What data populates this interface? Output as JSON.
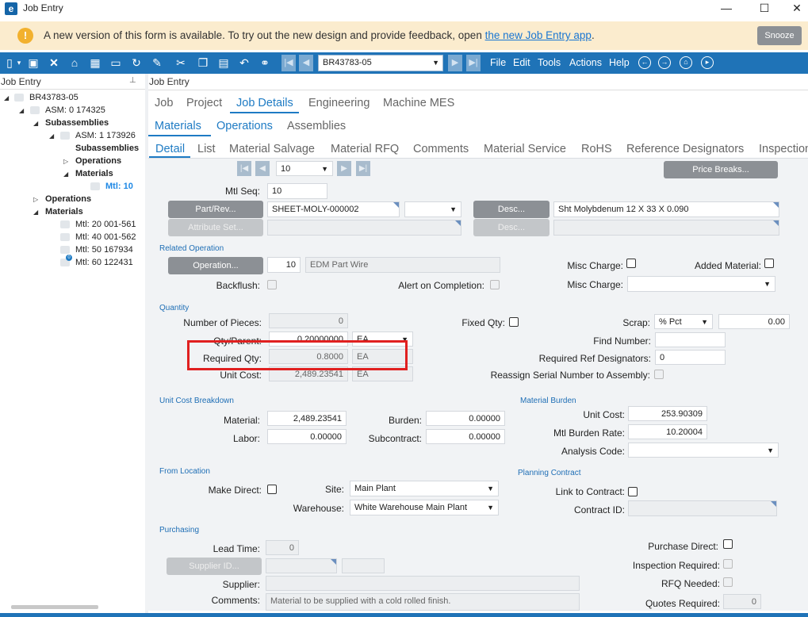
{
  "window": {
    "title": "Job Entry",
    "app_icon": "e",
    "minimize": "—",
    "maximize": "☐",
    "close": "✕"
  },
  "banner": {
    "text": "A new version of this form is available. To try out the new design and provide feedback, open ",
    "link": "the new Job Entry app",
    "link_suffix": ".",
    "snooze": "Snooze",
    "icon": "!"
  },
  "toolbar": {
    "job_value": "BR43783-05",
    "menu": [
      "File",
      "Edit",
      "Tools",
      "Actions",
      "Help"
    ]
  },
  "left_panel": {
    "title": "Job Entry",
    "tree": [
      "BR43783-05",
      "ASM: 0 174325",
      "Subassemblies",
      "ASM: 1 173926",
      "Subassemblies",
      "Operations",
      "Materials",
      "Mtl: 10",
      "Operations",
      "Materials",
      "Mtl: 20 001-561",
      "Mtl: 40 001-562",
      "Mtl: 50 167934",
      "Mtl: 60 122431"
    ],
    "badge": "0"
  },
  "main": {
    "title": "Job Entry",
    "tabs_level1": [
      "Job",
      "Project",
      "Job Details",
      "Engineering",
      "Machine MES"
    ],
    "tabs_level2": [
      "Materials",
      "Operations",
      "Assemblies"
    ],
    "tabs_level3": [
      "Detail",
      "List",
      "Material Salvage",
      "Material RFQ",
      "Comments",
      "Material Service",
      "RoHS",
      "Reference Designators",
      "Inspection"
    ]
  },
  "form": {
    "pager_value": "10",
    "price_breaks": "Price Breaks...",
    "mtl_seq_label": "Mtl Seq:",
    "mtl_seq": "10",
    "part_rev_btn": "Part/Rev...",
    "part_num": "SHEET-MOLY-000002",
    "desc_btn": "Desc...",
    "desc": "Sht Molybdenum 12 X 33 X 0.090",
    "attribute_set_btn": "Attribute Set...",
    "desc2_btn": "Desc...",
    "related_operation": "Related Operation",
    "operation_btn": "Operation...",
    "operation_num": "10",
    "operation_desc": "EDM Part Wire",
    "misc_charge_label": "Misc Charge:",
    "added_material_label": "Added Material:",
    "backflush_label": "Backflush:",
    "alert_label": "Alert on Completion:",
    "misc_charge2_label": "Misc Charge:",
    "quantity": "Quantity",
    "pieces_label": "Number of Pieces:",
    "pieces": "0",
    "fixed_qty_label": "Fixed Qty:",
    "scrap_label": "Scrap:",
    "scrap_type": "% Pct",
    "scrap_value": "0.00",
    "qty_parent_label": "Qty/Parent:",
    "qty_parent": "0.20000000",
    "qty_parent_uom": "EA",
    "find_number_label": "Find Number:",
    "required_qty_label": "Required Qty:",
    "required_qty": "0.8000",
    "required_qty_uom": "EA",
    "ref_designators_label": "Required Ref Designators:",
    "ref_designators": "0",
    "unit_cost_label": "Unit Cost:",
    "unit_cost": "2,489.23541",
    "unit_cost_uom": "EA",
    "reassign_label": "Reassign Serial Number to Assembly:",
    "unit_cost_breakdown": "Unit Cost Breakdown",
    "material_label": "Material:",
    "material": "2,489.23541",
    "burden_label": "Burden:",
    "burden": "0.00000",
    "labor_label": "Labor:",
    "labor": "0.00000",
    "subcontract_label": "Subcontract:",
    "subcontract": "0.00000",
    "material_burden": "Material Burden",
    "mb_unit_cost_label": "Unit Cost:",
    "mb_unit_cost": "253.90309",
    "mb_rate_label": "Mtl  Burden Rate:",
    "mb_rate": "10.20004",
    "analysis_label": "Analysis Code:",
    "from_location": "From Location",
    "make_direct_label": "Make Direct:",
    "site_label": "Site:",
    "site": "Main Plant",
    "warehouse_label": "Warehouse:",
    "warehouse": "White Warehouse Main Plant",
    "planning_contract": "Planning Contract",
    "link_contract_label": "Link to Contract:",
    "contract_id_label": "Contract ID:",
    "purchasing": "Purchasing",
    "lead_time_label": "Lead Time:",
    "lead_time": "0",
    "supplier_id_btn": "Supplier ID...",
    "supplier_label": "Supplier:",
    "comments_label": "Comments:",
    "comments": "Material to be supplied with a cold rolled finish.",
    "purchase_direct_label": "Purchase Direct:",
    "inspection_label": "Inspection  Required:",
    "rfq_label": "RFQ Needed:",
    "quotes_label": "Quotes Required:",
    "quotes": "0"
  },
  "colors": {
    "toolbar": "#1f73b7",
    "accent": "#1e7bc4",
    "banner": "#fbecce",
    "highlight": "#e02020"
  }
}
